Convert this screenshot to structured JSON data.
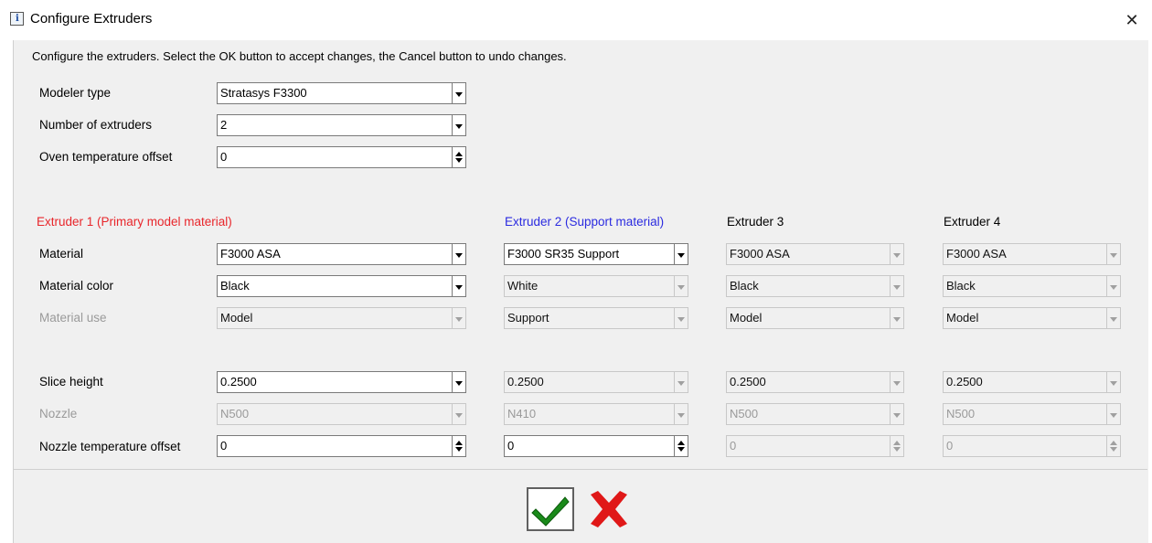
{
  "window": {
    "title": "Configure Extruders",
    "close_symbol": "✕"
  },
  "instruction": "Configure the extruders. Select the OK button to accept changes, the Cancel button to undo changes.",
  "general": {
    "modeler_type": {
      "label": "Modeler type",
      "value": "Stratasys F3300"
    },
    "num_extruders": {
      "label": "Number of extruders",
      "value": "2"
    },
    "oven_offset": {
      "label": "Oven temperature offset",
      "value": "0"
    }
  },
  "row_labels": {
    "material": "Material",
    "material_color": "Material color",
    "material_use": "Material use",
    "slice_height": "Slice height",
    "nozzle": "Nozzle",
    "nozzle_temp_offset": "Nozzle temperature offset"
  },
  "extruders": [
    {
      "header": "Extruder 1 (Primary model material)",
      "header_color": "#e8262b",
      "material": "F3000 ASA",
      "material_color": "Black",
      "material_use": "Model",
      "slice_height": "0.2500",
      "nozzle": "N500",
      "nozzle_temp_offset": "0"
    },
    {
      "header": "Extruder 2 (Support material)",
      "header_color": "#2b2be0",
      "material": "F3000 SR35 Support",
      "material_color": "White",
      "material_use": "Support",
      "slice_height": "0.2500",
      "nozzle": "N410",
      "nozzle_temp_offset": "0"
    },
    {
      "header": "Extruder 3",
      "header_color": "#000000",
      "material": "F3000 ASA",
      "material_color": "Black",
      "material_use": "Model",
      "slice_height": "0.2500",
      "nozzle": "N500",
      "nozzle_temp_offset": "0"
    },
    {
      "header": "Extruder 4",
      "header_color": "#000000",
      "material": "F3000 ASA",
      "material_color": "Black",
      "material_use": "Model",
      "slice_height": "0.2500",
      "nozzle": "N500",
      "nozzle_temp_offset": "0"
    }
  ],
  "buttons": {
    "ok": {
      "icon": "checkmark-icon",
      "color": "#1a8a1a"
    },
    "cancel": {
      "icon": "x-icon",
      "color": "#e01818"
    }
  }
}
